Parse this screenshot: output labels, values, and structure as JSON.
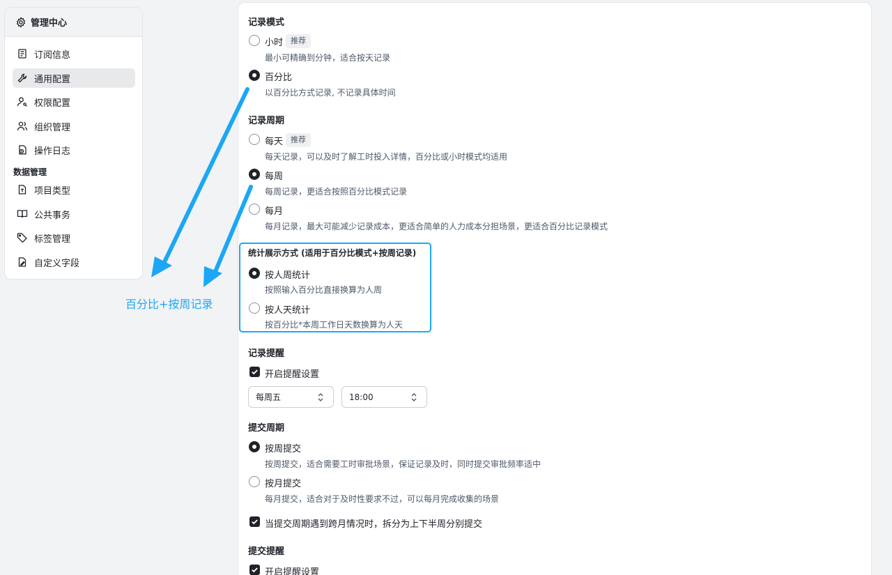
{
  "sidebar": {
    "title": "管理中心",
    "items": [
      {
        "label": "订阅信息",
        "icon": "subscription-icon"
      },
      {
        "label": "通用配置",
        "icon": "wrench-icon"
      },
      {
        "label": "权限配置",
        "icon": "user-key-icon"
      },
      {
        "label": "组织管理",
        "icon": "users-icon"
      },
      {
        "label": "操作日志",
        "icon": "log-icon"
      }
    ],
    "section_data": "数据管理",
    "data_items": [
      {
        "label": "项目类型",
        "icon": "project-type-icon"
      },
      {
        "label": "公共事务",
        "icon": "book-icon"
      },
      {
        "label": "标签管理",
        "icon": "tag-icon"
      },
      {
        "label": "自定义字段",
        "icon": "custom-field-icon"
      }
    ]
  },
  "record_mode": {
    "title": "记录模式",
    "options": [
      {
        "label": "小时",
        "badge": "推荐",
        "desc": "最小可精确到分钟，适合按天记录",
        "checked": false
      },
      {
        "label": "百分比",
        "desc": "以百分比方式记录, 不记录具体时间",
        "checked": true
      }
    ]
  },
  "record_cycle": {
    "title": "记录周期",
    "options": [
      {
        "label": "每天",
        "badge": "推荐",
        "desc": "每天记录，可以及时了解工时投入详情，百分比或小时模式均适用",
        "checked": false
      },
      {
        "label": "每周",
        "desc": "每周记录，更适合按照百分比模式记录",
        "checked": true
      },
      {
        "label": "每月",
        "desc": "每月记录，最大可能减少记录成本，更适合简单的人力成本分担场景，更适合百分比记录模式",
        "checked": false
      }
    ]
  },
  "stat_display": {
    "title": "统计展示方式 (适用于百分比模式+按周记录)",
    "options": [
      {
        "label": "按人周统计",
        "desc": "按照输入百分比直接换算为人周",
        "checked": true
      },
      {
        "label": "按人天统计",
        "desc": "按百分比*本周工作日天数换算为人天",
        "checked": false
      }
    ]
  },
  "record_reminder": {
    "title": "记录提醒",
    "checkbox_label": "开启提醒设置",
    "day_value": "每周五",
    "time_value": "18:00"
  },
  "submit_cycle": {
    "title": "提交周期",
    "options": [
      {
        "label": "按周提交",
        "desc": "按周提交，适合需要工时审批场景，保证记录及时，同时提交审批频率适中",
        "checked": true
      },
      {
        "label": "按月提交",
        "desc": "每月提交，适合对于及时性要求不过，可以每月完成收集的场景",
        "checked": false
      }
    ],
    "split_label": "当提交周期遇到跨月情况时，拆分为上下半周分别提交"
  },
  "submit_reminder": {
    "title": "提交提醒",
    "checkbox_label": "开启提醒设置"
  },
  "annotation": {
    "text": "百分比+按周记录",
    "color": "#1ba7f5"
  }
}
